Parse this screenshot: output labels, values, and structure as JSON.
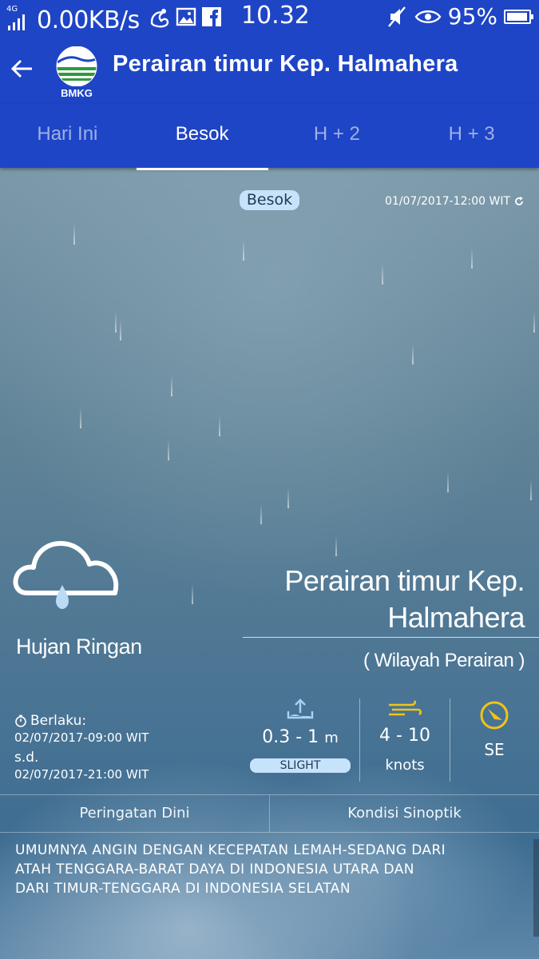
{
  "status_bar": {
    "network": "4G",
    "speed": "0.00KB/s",
    "time": "10.32",
    "battery": "95%",
    "battery_level": 0.95,
    "icons": [
      "signal-icon",
      "uc-browser-icon",
      "gallery-icon",
      "facebook-icon",
      "mute-icon",
      "eye-icon",
      "battery-icon"
    ]
  },
  "app_bar": {
    "logo_text": "BMKG",
    "title": "Perairan timur Kep. Halmahera"
  },
  "tabs": [
    {
      "label": "Hari Ini",
      "active": false
    },
    {
      "label": "Besok",
      "active": true
    },
    {
      "label": "H + 2",
      "active": false
    },
    {
      "label": "H + 3",
      "active": false
    }
  ],
  "forecast": {
    "day_chip": "Besok",
    "issued": "01/07/2017-12:00 WIT",
    "condition": "Hujan Ringan",
    "location": "Perairan timur Kep. Halmahera",
    "region": "( Wilayah Perairan )",
    "valid_label": "Berlaku:",
    "valid_from": "02/07/2017-09:00 WIT",
    "valid_sd": "s.d.",
    "valid_to": "02/07/2017-21:00 WIT",
    "wave_value": "0.3 - 1",
    "wave_unit": "m",
    "wave_class": "SLIGHT",
    "wind_value": "4 - 10",
    "wind_unit": "knots",
    "wind_direction": "SE"
  },
  "buttons": {
    "warning": "Peringatan Dini",
    "synoptic": "Kondisi Sinoptik"
  },
  "synopsis_lines": [
    "UMUMNYA ANGIN DENGAN KECEPATAN LEMAH-SEDANG DARI",
    "ATAH TENGGARA-BARAT DAYA DI INDONESIA UTARA DAN",
    "DARI TIMUR-TENGGARA DI INDONESIA SELATAN"
  ]
}
